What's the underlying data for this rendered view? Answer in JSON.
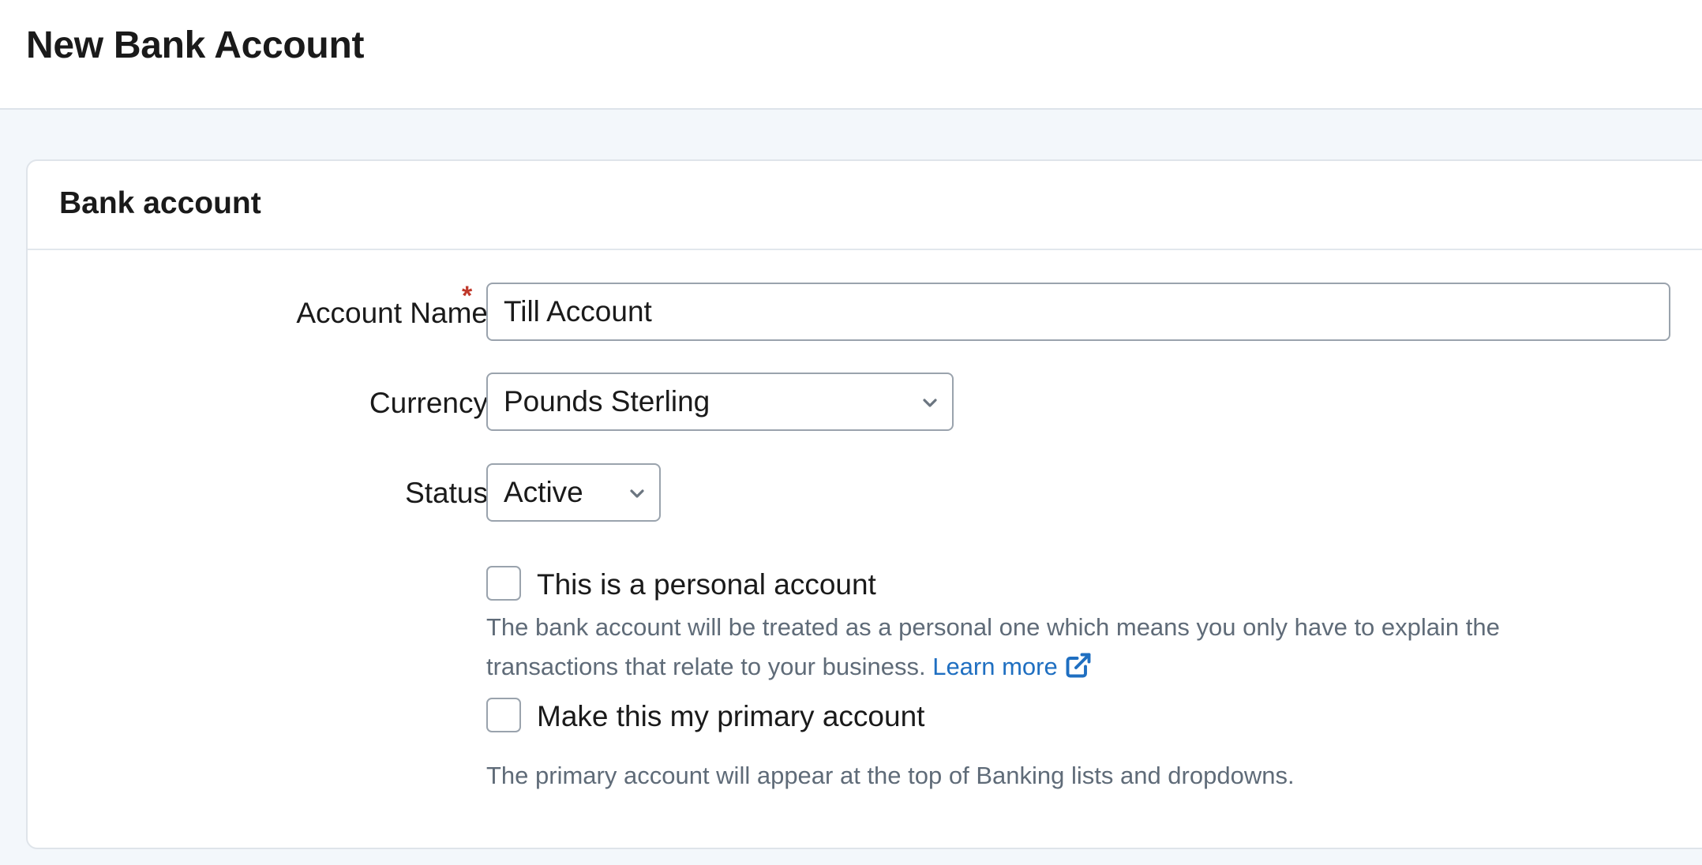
{
  "page": {
    "title": "New Bank Account"
  },
  "card": {
    "title": "Bank account"
  },
  "form": {
    "account_name": {
      "label": "Account Name",
      "required_mark": "*",
      "value": "Till Account"
    },
    "currency": {
      "label": "Currency",
      "value": "Pounds Sterling"
    },
    "status": {
      "label": "Status",
      "value": "Active"
    },
    "personal_account": {
      "label": "This is a personal account",
      "checked": false,
      "help_text": "The bank account will be treated as a personal one which means you only have to explain the",
      "help_text_line2": "transactions that relate to your business.",
      "learn_more": "Learn more",
      "learn_more_icon": "external-link-icon"
    },
    "primary_account": {
      "label": "Make this my primary account",
      "checked": false,
      "help_text": "The primary account will appear at the top of Banking lists and dropdowns."
    }
  },
  "colors": {
    "page_background": "#f3f7fb",
    "required": "#c0392b",
    "link": "#1f6fc1",
    "help_text": "#5f6b78"
  }
}
